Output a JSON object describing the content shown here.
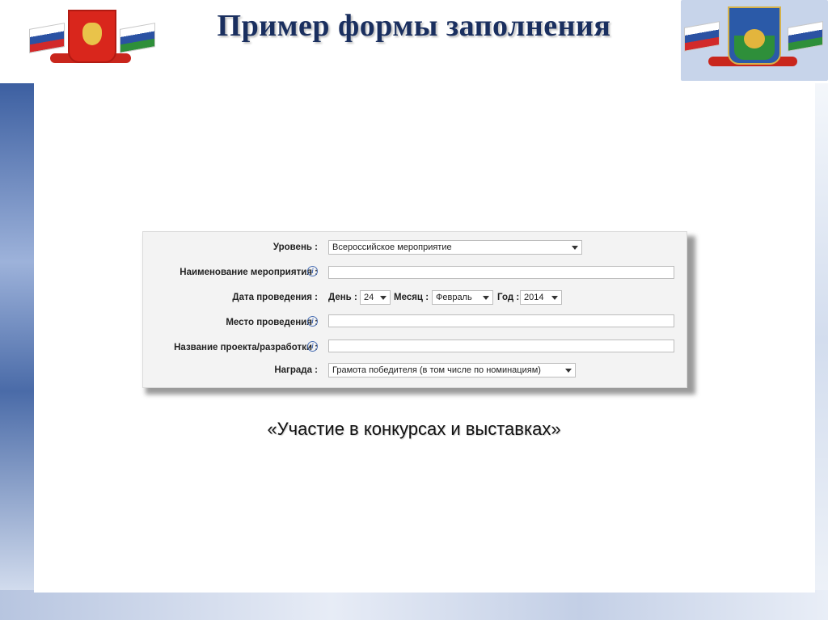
{
  "slide": {
    "title": "Пример формы заполнения",
    "caption": "«Участие в конкурсах и выставках»"
  },
  "form": {
    "level": {
      "label": "Уровень :",
      "value": "Всероссийское мероприятие"
    },
    "event_name": {
      "label": "Наименование мероприятия :",
      "value": ""
    },
    "date": {
      "label": "Дата проведения :",
      "day_label": "День :",
      "day_value": "24",
      "month_label": "Месяц :",
      "month_value": "Февраль",
      "year_label": "Год :",
      "year_value": "2014"
    },
    "place": {
      "label": "Место проведения :",
      "value": ""
    },
    "project_name": {
      "label": "Название проекта/разработки :",
      "value": ""
    },
    "award": {
      "label": "Награда :",
      "value": "Грамота победителя (в том числе по номинациям)"
    }
  },
  "icons": {
    "info": "i"
  },
  "colors": {
    "title": "#1a2f5f",
    "form_background": "#f3f3f3",
    "info_icon": "#4a6fb4"
  }
}
